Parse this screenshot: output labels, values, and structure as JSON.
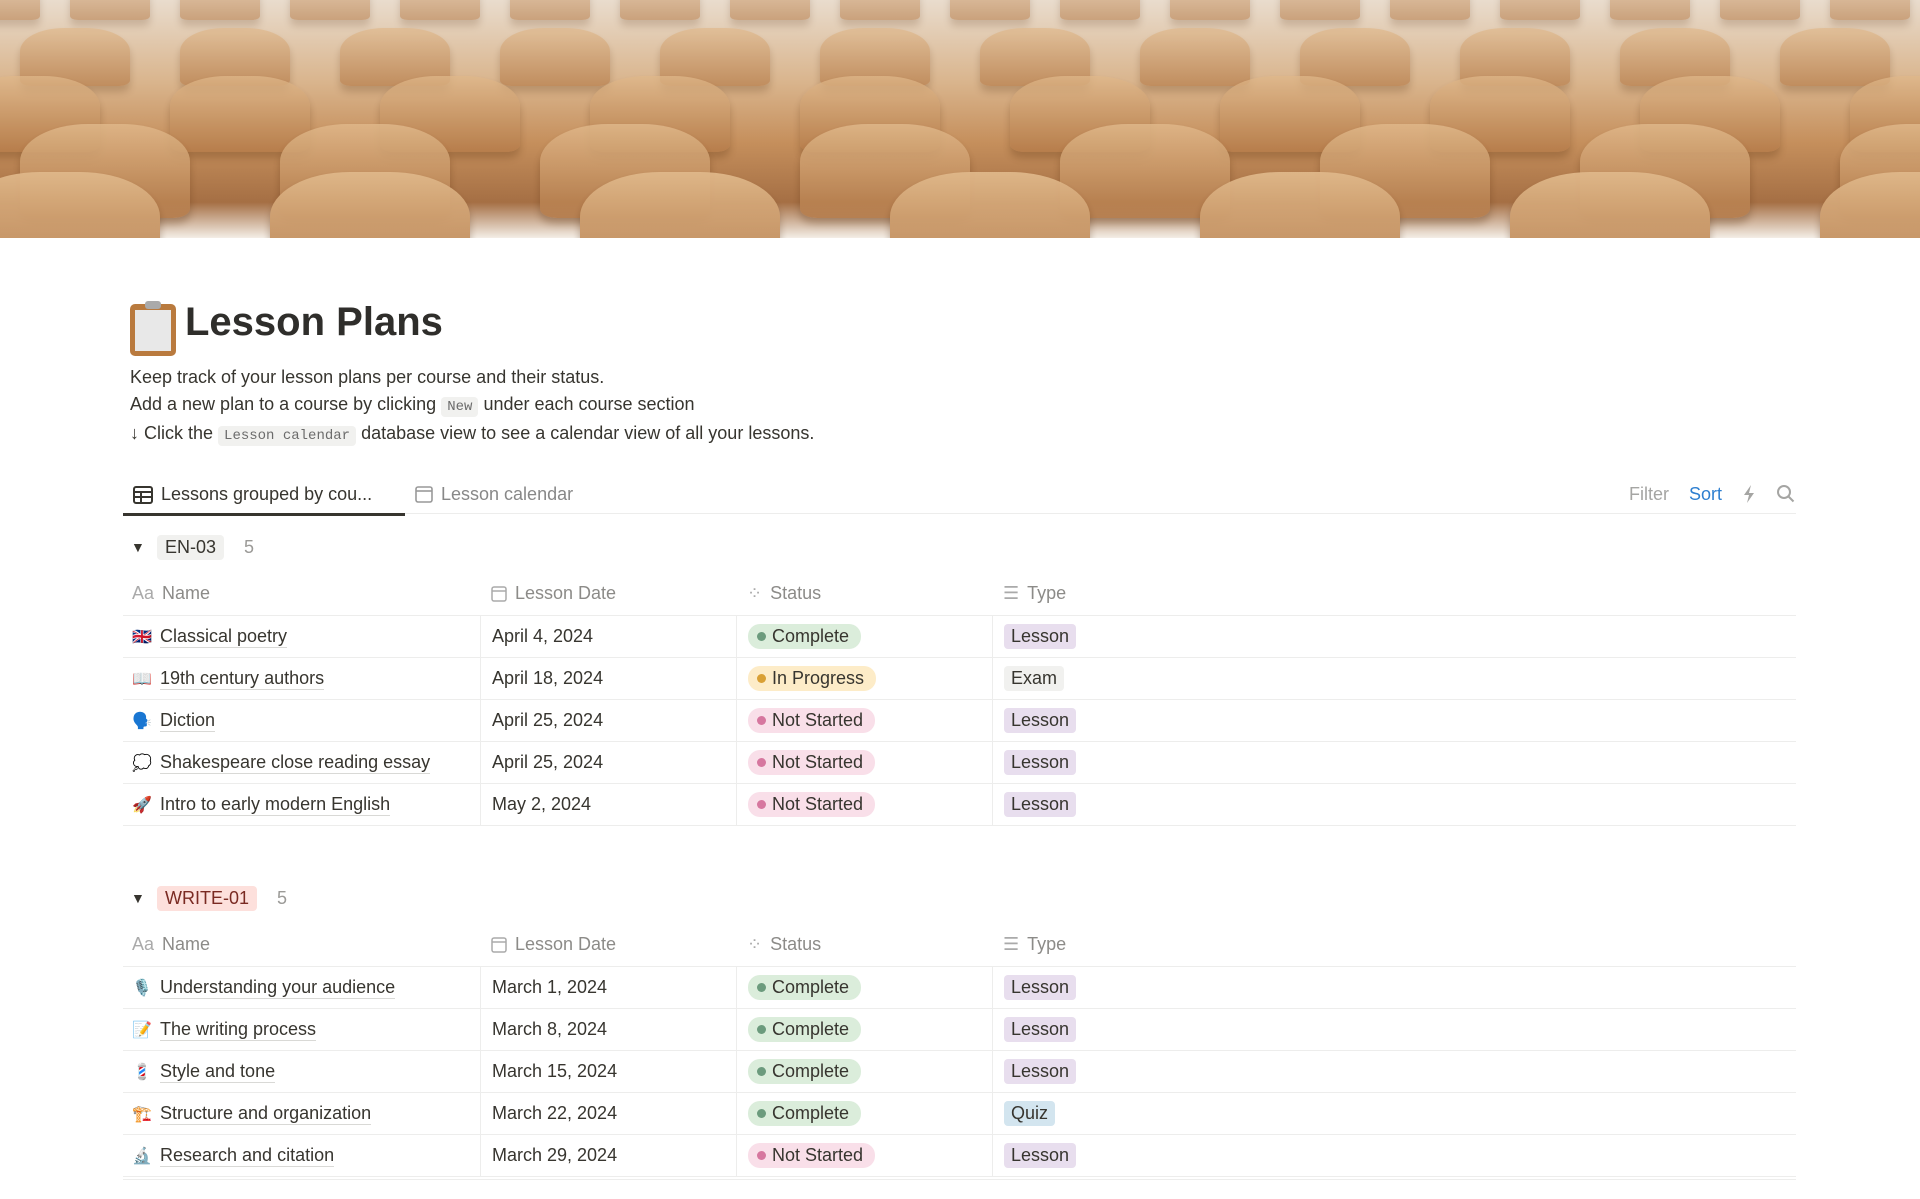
{
  "page": {
    "title": "Lesson Plans",
    "icon": "clipboard-icon",
    "desc1": "Keep track of your lesson plans per course and their status.",
    "desc2_a": "Add a new plan to a course by clicking",
    "desc2_code": "New",
    "desc2_b": "under each course section",
    "desc3_a": "↓ Click the",
    "desc3_code": "Lesson calendar",
    "desc3_b": "database view to see a calendar view of all your lessons."
  },
  "tabs": [
    {
      "label": "Lessons grouped by cou...",
      "icon": "table-icon",
      "active": true
    },
    {
      "label": "Lesson calendar",
      "icon": "calendar-icon",
      "active": false
    }
  ],
  "toolbar": {
    "filter": "Filter",
    "sort": "Sort",
    "automation_icon": "lightning-icon",
    "search_icon": "search-icon"
  },
  "columns": {
    "name": "Name",
    "date": "Lesson Date",
    "status": "Status",
    "type": "Type"
  },
  "colors": {
    "Complete": {
      "bg": "#dbeddb",
      "dot": "#6c9b7d"
    },
    "In Progress": {
      "bg": "#fdecc8",
      "dot": "#d9a035"
    },
    "Not Started": {
      "bg": "#f9dfe9",
      "dot": "#d6779f"
    },
    "Lesson": "#e8deee",
    "Exam": "#f1f1ef",
    "Quiz": "#d3e5ef"
  },
  "groups": [
    {
      "name": "EN-03",
      "count": "5",
      "tag_bg": "#f1f1ef",
      "tag_color": "#37352f",
      "rows": [
        {
          "emoji": "🇬🇧",
          "name": "Classical poetry",
          "date": "April 4, 2024",
          "status": "Complete",
          "type": "Lesson"
        },
        {
          "emoji": "📖",
          "name": "19th century authors",
          "date": "April 18, 2024",
          "status": "In Progress",
          "type": "Exam"
        },
        {
          "emoji": "🗣️",
          "name": "Diction",
          "date": "April 25, 2024",
          "status": "Not Started",
          "type": "Lesson"
        },
        {
          "emoji": "💭",
          "name": "Shakespeare close reading essay",
          "date": "April 25, 2024",
          "status": "Not Started",
          "type": "Lesson"
        },
        {
          "emoji": "🚀",
          "name": "Intro to early modern English",
          "date": "May 2, 2024",
          "status": "Not Started",
          "type": "Lesson"
        }
      ]
    },
    {
      "name": "WRITE-01",
      "count": "5",
      "tag_bg": "#fde0dc",
      "tag_color": "#7a2a22",
      "rows": [
        {
          "emoji": "🎙️",
          "name": "Understanding your audience",
          "date": "March 1, 2024",
          "status": "Complete",
          "type": "Lesson"
        },
        {
          "emoji": "📝",
          "name": "The writing process",
          "date": "March 8, 2024",
          "status": "Complete",
          "type": "Lesson"
        },
        {
          "emoji": "💈",
          "name": "Style and tone",
          "date": "March 15, 2024",
          "status": "Complete",
          "type": "Lesson"
        },
        {
          "emoji": "🏗️",
          "name": "Structure and organization",
          "date": "March 22, 2024",
          "status": "Complete",
          "type": "Quiz"
        },
        {
          "emoji": "🔬",
          "name": "Research and citation",
          "date": "March 29, 2024",
          "status": "Not Started",
          "type": "Lesson"
        }
      ]
    }
  ]
}
